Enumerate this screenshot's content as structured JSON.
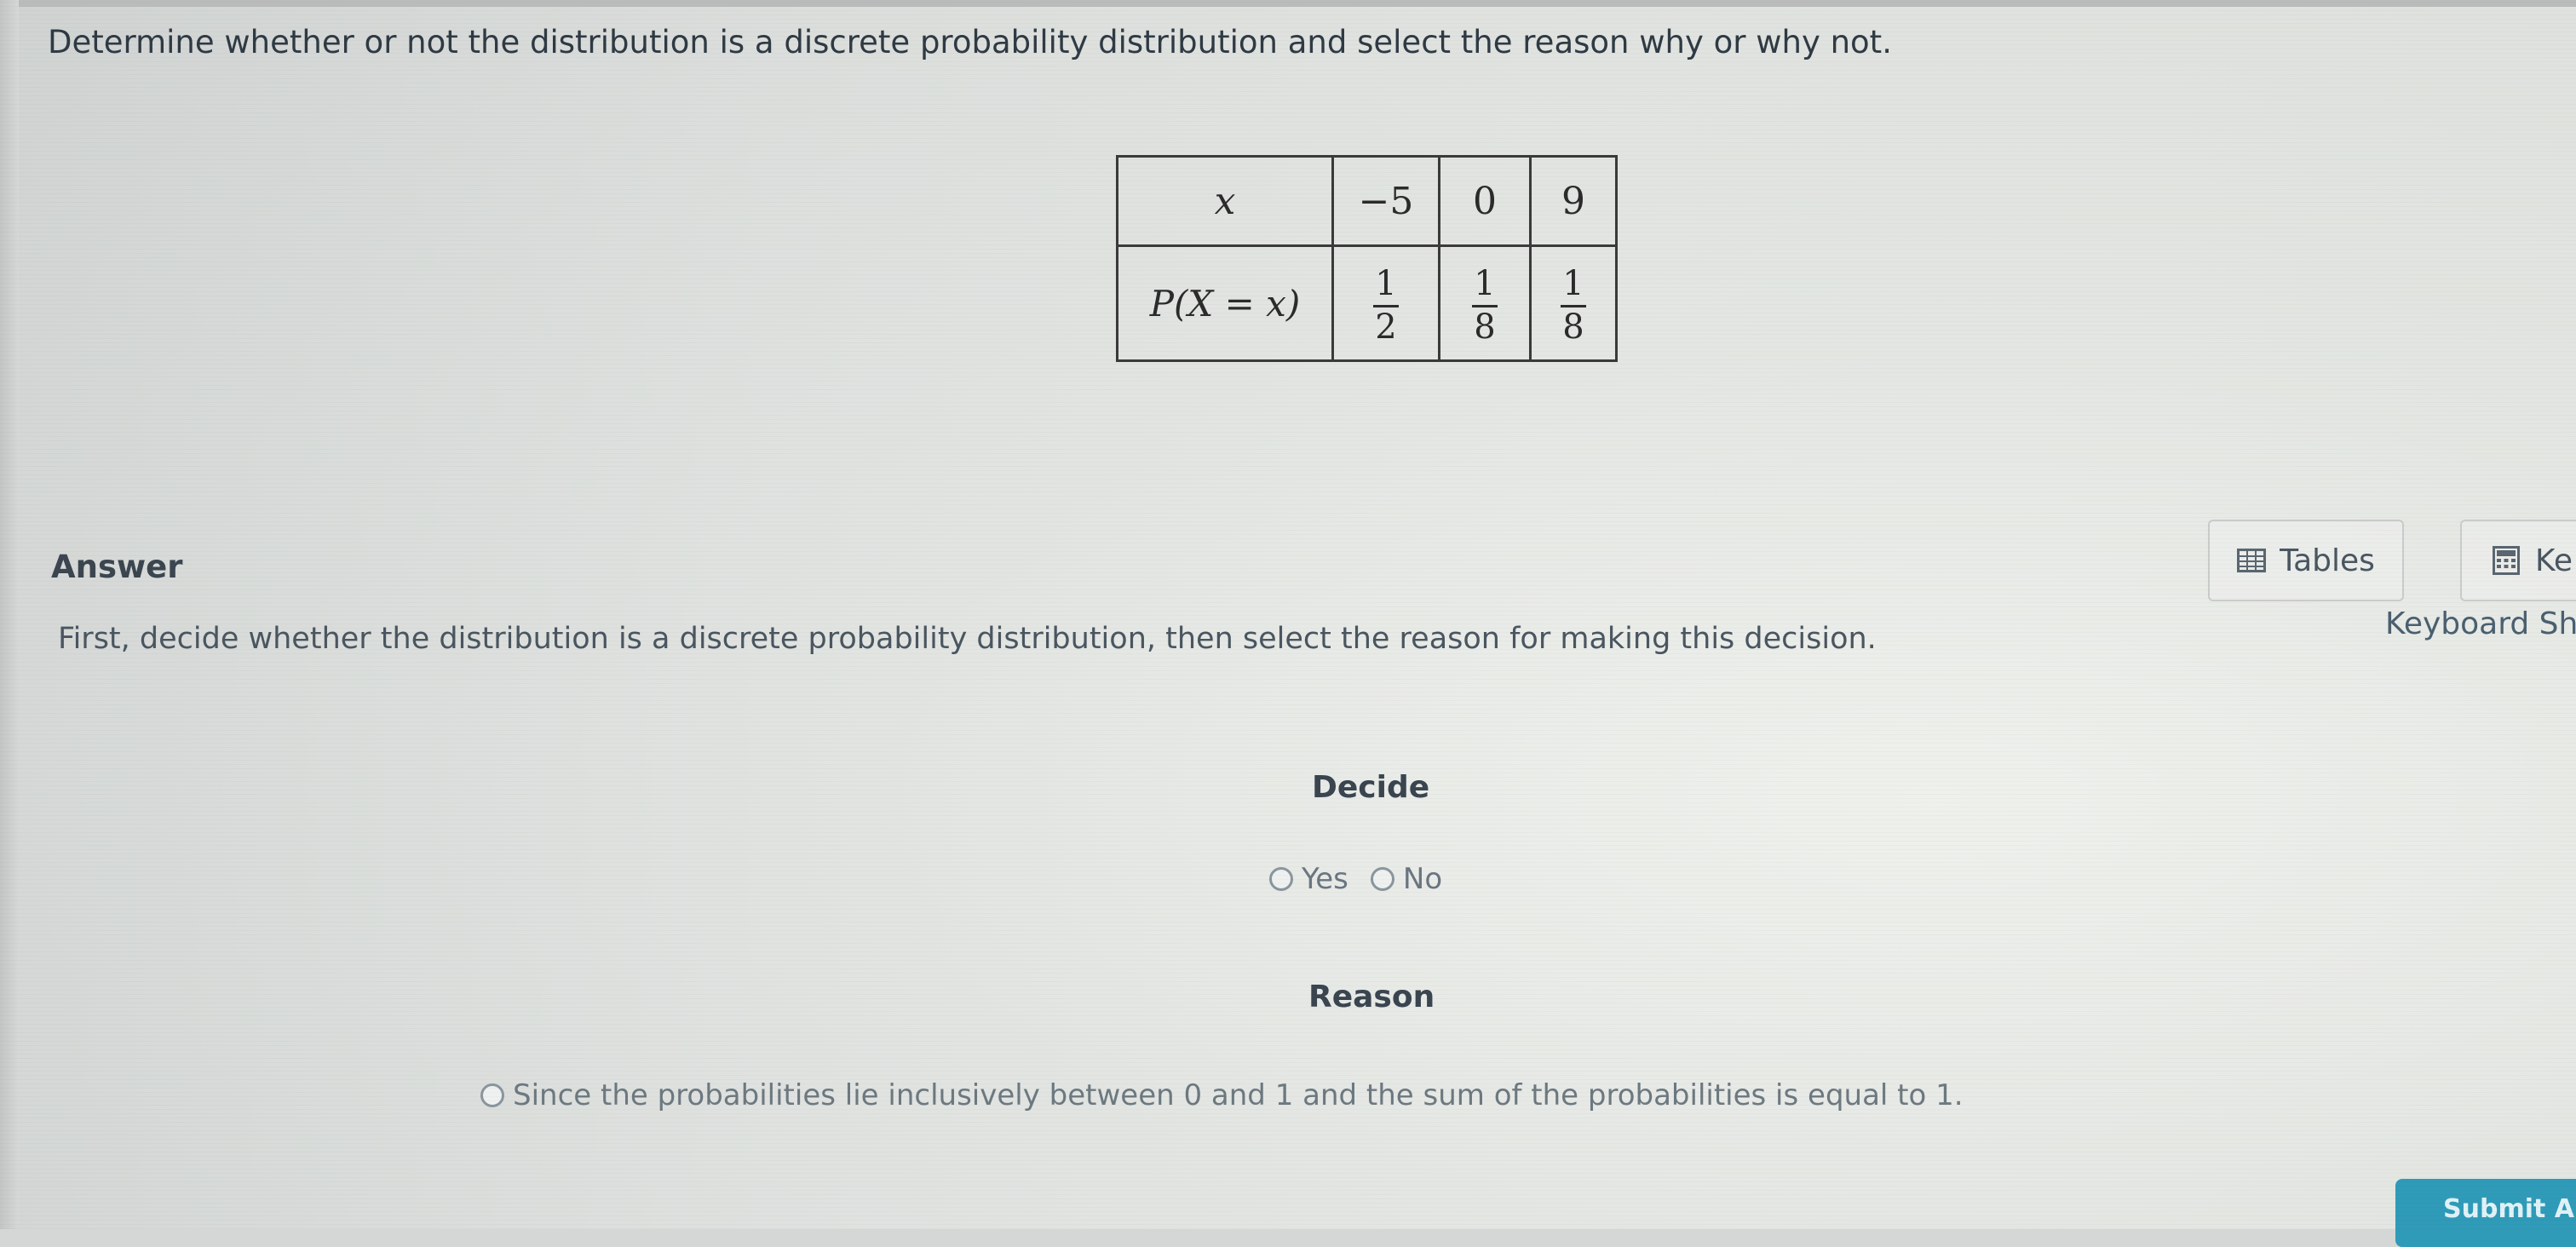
{
  "question": {
    "text": "Determine whether or not the distribution is a discrete probability distribution and select the reason why or why not."
  },
  "distribution_table": {
    "x_header": "x",
    "p_header": "P(X = x)",
    "columns": [
      {
        "x": "−5",
        "p_num": "1",
        "p_den": "2"
      },
      {
        "x": "0",
        "p_num": "1",
        "p_den": "8"
      },
      {
        "x": "9",
        "p_num": "1",
        "p_den": "8"
      }
    ]
  },
  "answer": {
    "label": "Answer",
    "instruction": "First, decide whether the distribution is a discrete probability distribution, then select the reason for making this decision.",
    "decide_label": "Decide",
    "decide_options": [
      "Yes",
      "No"
    ],
    "reason_label": "Reason",
    "reason_options": [
      "Since the probabilities lie inclusively between 0 and 1 and the sum of the probabilities is equal to 1."
    ]
  },
  "toolbar": {
    "tables_label": "Tables",
    "keypad_label": "Ke",
    "keyboard_shortcuts_label": "Keyboard Sh",
    "submit_label": "Submit An"
  },
  "icons": {
    "tables": "table-grid-icon",
    "keypad": "calculator-icon",
    "radio": "radio-circle"
  },
  "colors": {
    "submit_button": "#2f9bb8",
    "question_text": "#2f3a44",
    "muted_text": "#6a7680"
  }
}
